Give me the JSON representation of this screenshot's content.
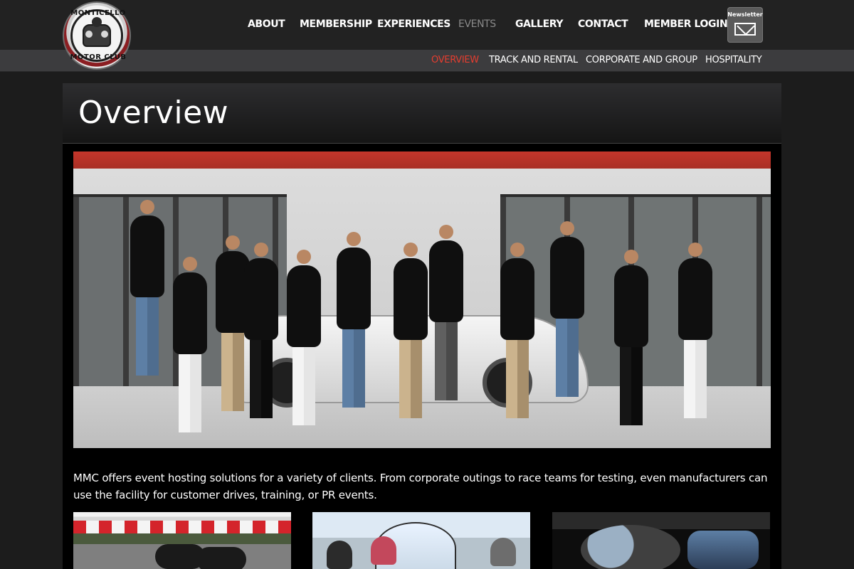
{
  "brand": {
    "logo_top": "MONTICELLO",
    "logo_bottom": "MOTOR CLUB"
  },
  "nav": {
    "items": [
      {
        "label": "ABOUT"
      },
      {
        "label": "MEMBERSHIP"
      },
      {
        "label": "EXPERIENCES"
      },
      {
        "label": "EVENTS",
        "active": true
      },
      {
        "label": "GALLERY"
      },
      {
        "label": "CONTACT"
      },
      {
        "label": "MEMBER LOGIN"
      }
    ],
    "newsletter_label": "Newsletter"
  },
  "subnav": {
    "items": [
      {
        "label": "OVERVIEW",
        "active": true
      },
      {
        "label": "TRACK AND RENTAL"
      },
      {
        "label": "CORPORATE AND GROUP"
      },
      {
        "label": "HOSPITALITY"
      }
    ]
  },
  "main": {
    "title": "Overview",
    "description": "MMC offers event hosting solutions for a variety of clients. From corporate outings to race teams for testing, even manufacturers can use the facility for customer drives, training, or PR events."
  },
  "colors": {
    "accent_red": "#e53d2f",
    "nav_inactive": "#8a8a8a",
    "header_bg": "#222222",
    "subnav_bg": "#3c3c3e",
    "page_bg": "#1c1c1c",
    "content_bg": "#000000"
  },
  "icons": {
    "newsletter": "envelope-icon"
  }
}
